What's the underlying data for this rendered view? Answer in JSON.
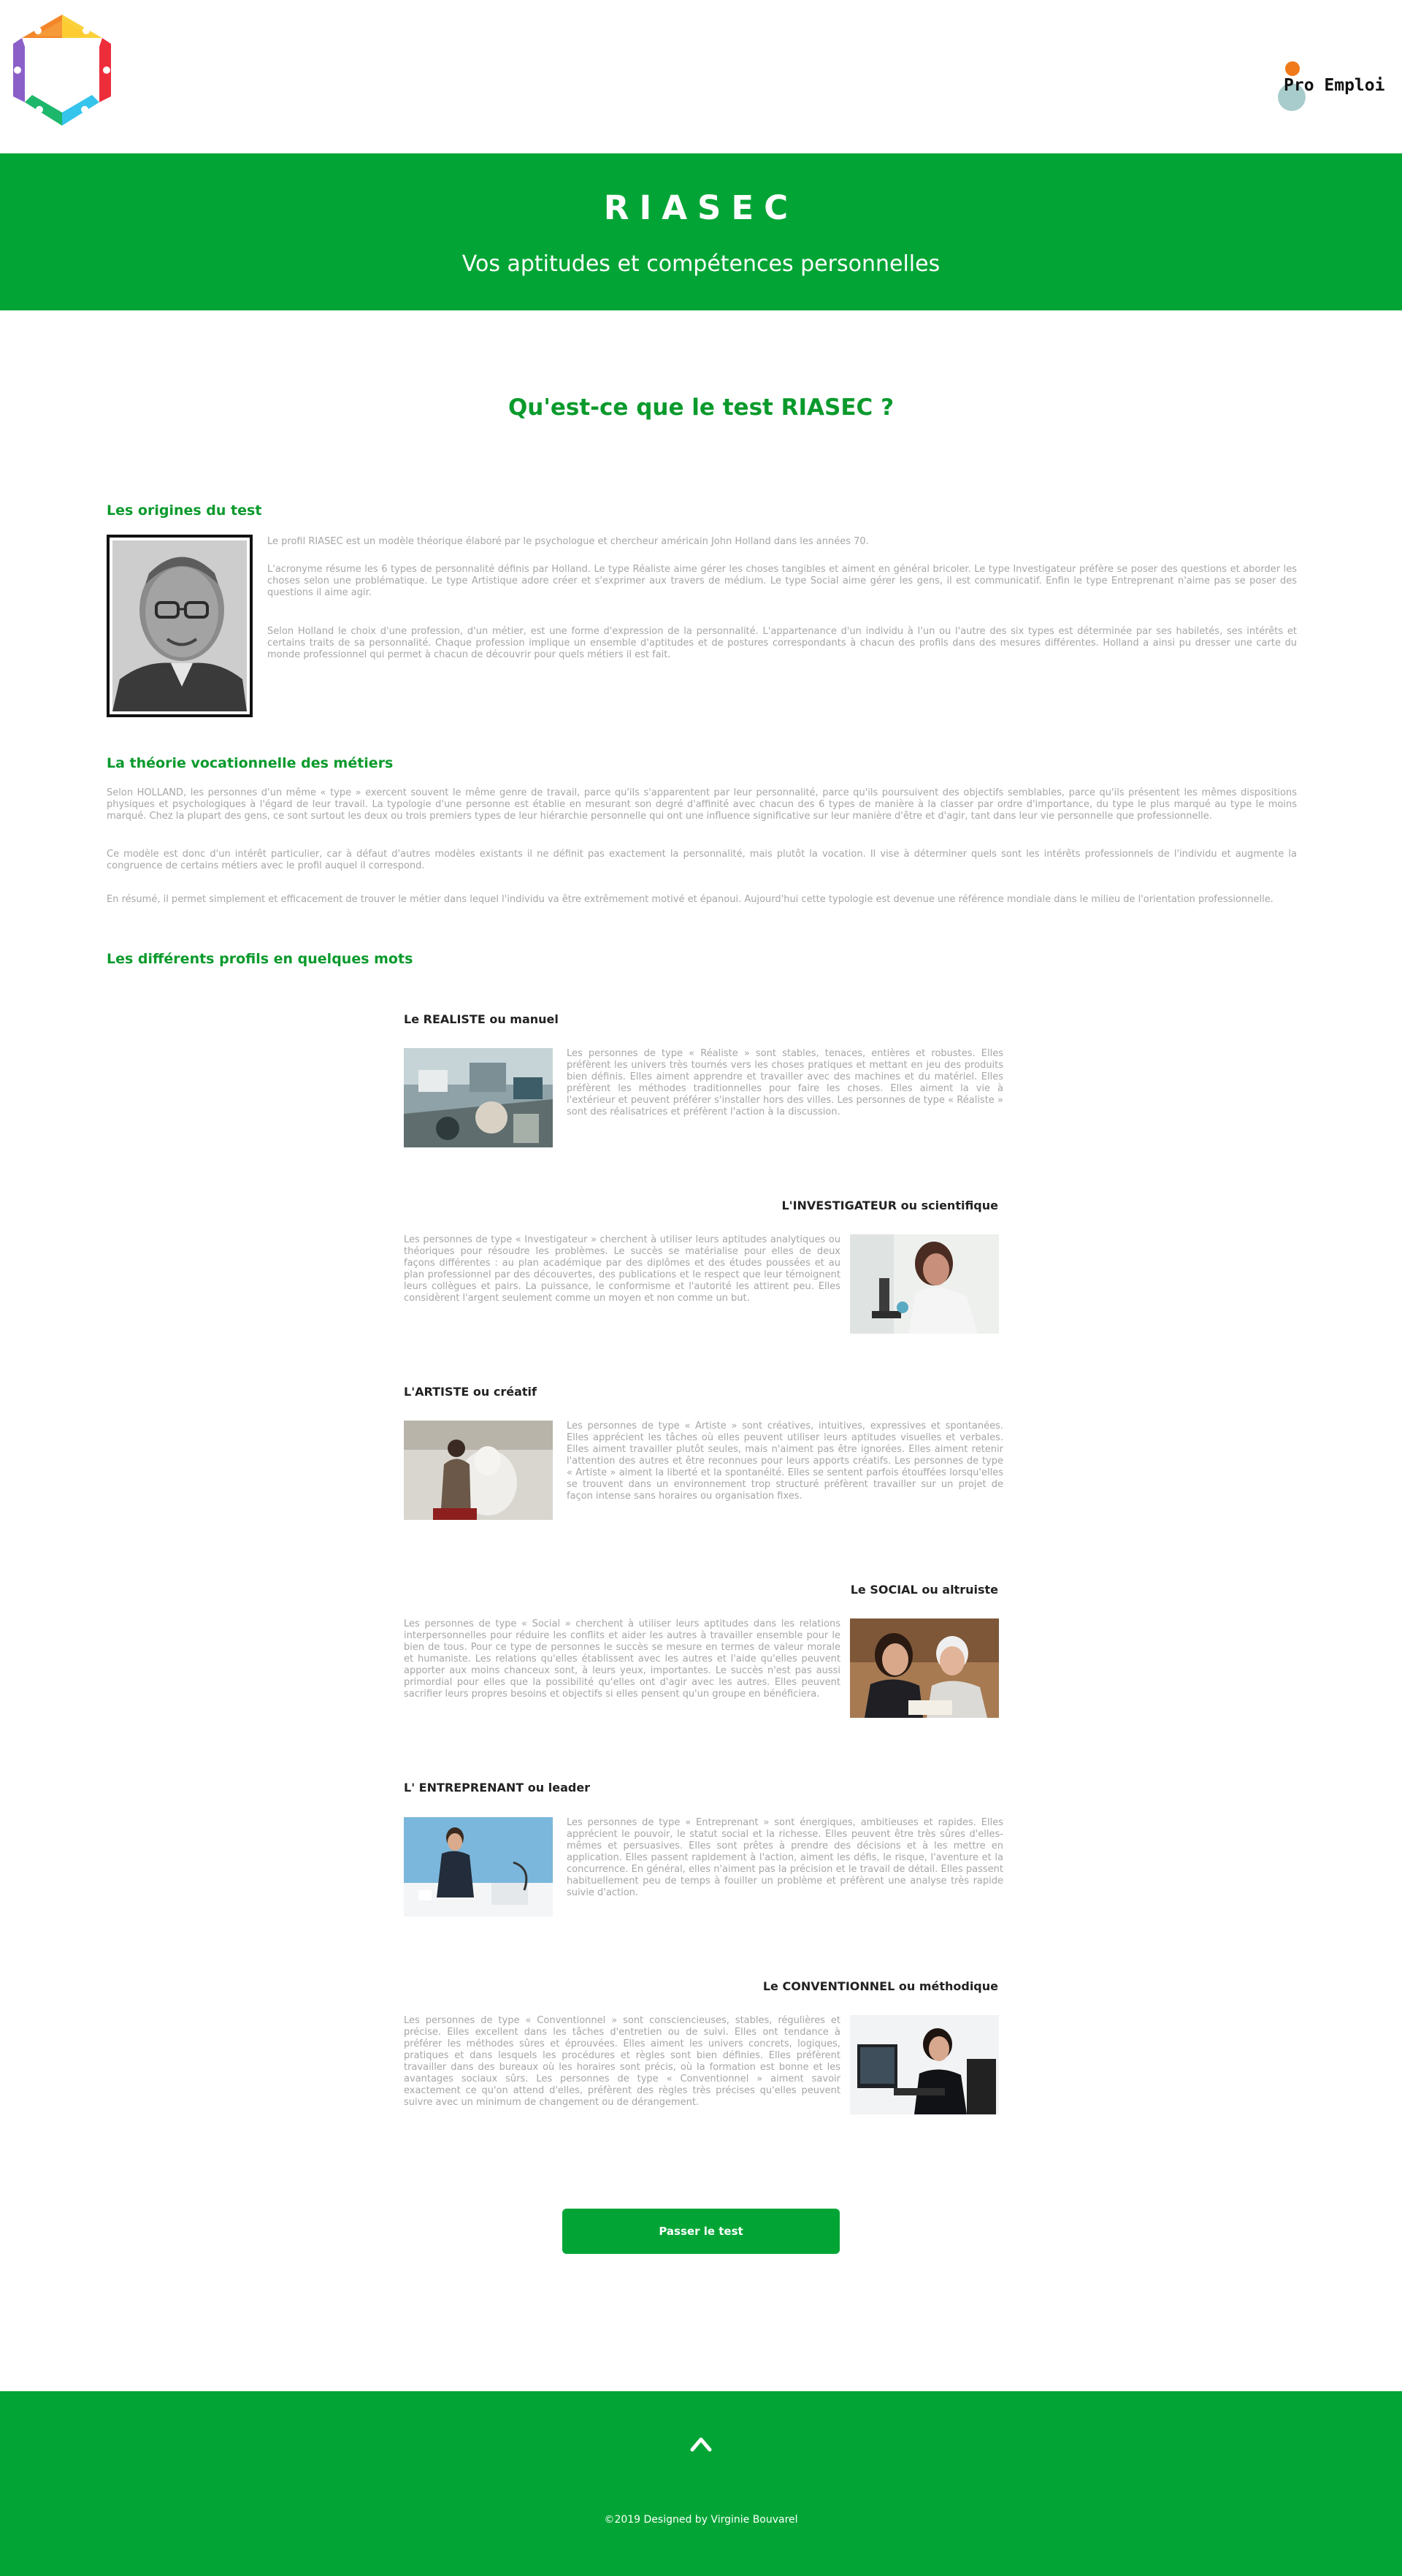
{
  "header": {
    "brand_name": "Pro Emploi",
    "logo_icon": "riasec-hexagon-logo-icon"
  },
  "hero": {
    "title": "RIASEC",
    "subtitle": "Vos aptitudes et compétences personnelles"
  },
  "main": {
    "title": "Qu'est-ce que le test RIASEC ?"
  },
  "origins": {
    "title": "Les origines du test",
    "paragraphs": [
      "Le profil RIASEC est un modèle théorique élaboré par le psychologue et chercheur américain John Holland dans les années 70.",
      "L'acronyme résume les 6 types de personnalité définis par Holland. Le type Réaliste aime gérer les choses tangibles et aiment en général bricoler. Le type Investigateur préfère se poser des questions et aborder les choses selon une problématique. Le type Artistique adore créer et s'exprimer aux travers de médium. Le type Social aime gérer les gens, il est communicatif. Enfin le type Entreprenant n'aime pas se poser des questions il aime agir.",
      "Selon Holland le choix d'une profession, d'un métier, est une forme d'expression de la personnalité. L'appartenance d'un individu à l'un ou l'autre des six types est déterminée par ses habiletés, ses intérêts et certains traits de sa personnalité. Chaque profession implique un ensemble d'aptitudes et de postures correspondants à chacun des profils dans des mesures différentes. Holland a ainsi pu dresser une carte du monde professionnel qui permet à chacun de découvrir pour quels métiers il est fait."
    ]
  },
  "theory": {
    "title": "La théorie vocationnelle des métiers",
    "paragraphs": [
      "Selon HOLLAND, les personnes d'un même « type » exercent souvent le même genre de travail, parce qu'ils s'apparentent par leur personnalité, parce qu'ils poursuivent des objectifs semblables, parce qu'ils présentent les mêmes dispositions physiques et psychologiques à l'égard de leur travail. La typologie d'une personne est établie en mesurant son degré d'affinité avec chacun des 6 types de manière à la classer par ordre d'importance, du type le plus marqué au type le moins marqué. Chez la plupart des gens, ce sont surtout les deux ou trois premiers types de leur hiérarchie personnelle qui ont une influence significative sur leur manière d'être et d'agir, tant dans leur vie personnelle que professionnelle.",
      "Ce modèle est donc d'un intérêt particulier, car à défaut d'autres modèles existants il ne définit pas exactement la personnalité, mais plutôt la vocation. Il vise à déterminer quels sont les intérêts professionnels de l'individu et augmente la congruence de certains métiers avec le profil auquel il correspond.",
      "En résumé, il permet simplement et efficacement de trouver le métier dans lequel l'individu va être extrêmement motivé et épanoui. Aujourd'hui cette typologie est devenue une référence mondiale dans le milieu de l'orientation professionnelle."
    ]
  },
  "profiles": {
    "title": "Les différents profils en quelques mots",
    "items": [
      {
        "title": "Le REALISTE ou manuel",
        "text": "Les personnes de type « Réaliste » sont stables, tenaces, entières et robustes. Elles préfèrent les univers très tournés vers les choses pratiques et mettant en jeu des produits bien définis. Elles aiment apprendre et travailler avec des machines et du matériel. Elles préfèrent les méthodes traditionnelles pour faire les choses. Elles aiment la vie à l'extérieur et peuvent préférer s'installer hors des villes. Les personnes de type « Réaliste » sont des réalisatrices et préfèrent l'action à la discussion."
      },
      {
        "title": "L'INVESTIGATEUR ou scientifique",
        "text": "Les personnes de type « Investigateur » cherchent à utiliser leurs aptitudes analytiques ou théoriques pour résoudre les problèmes. Le succès se matérialise pour elles de deux façons différentes : au plan académique par des diplômes et des études poussées et au plan professionnel par des découvertes, des publications et le respect que leur témoignent leurs collègues et pairs. La puissance, le conformisme et l'autorité les attirent peu. Elles considèrent l'argent seulement comme un moyen et non comme un but."
      },
      {
        "title": "L'ARTISTE ou créatif",
        "text": "Les personnes de type « Artiste » sont créatives, intuitives, expressives et spontanées. Elles apprécient les tâches où elles peuvent utiliser leurs aptitudes visuelles et verbales. Elles aiment travailler plutôt seules, mais n'aiment pas être ignorées. Elles aiment retenir l'attention des autres et être reconnues pour leurs apports créatifs. Les personnes de type « Artiste » aiment la liberté et la spontanéité. Elles se sentent parfois étouffées lorsqu'elles se trouvent dans un environnement trop structuré préfèrent travailler sur un projet de façon intense sans horaires ou organisation fixes."
      },
      {
        "title": "Le SOCIAL ou altruiste",
        "text": "Les personnes de type « Social » cherchent à utiliser leurs aptitudes dans les relations interpersonnelles pour réduire les conflits et aider les autres à travailler ensemble pour le bien de tous. Pour ce type de personnes le succès se mesure en termes de valeur morale et humaniste. Les relations qu'elles établissent avec les autres et l'aide qu'elles peuvent apporter aux moins chanceux sont, à leurs yeux, importantes. Le succès n'est pas aussi primordial pour elles que la possibilité qu'elles ont d'agir avec les autres. Elles peuvent sacrifier leurs propres besoins et objectifs si elles pensent qu'un groupe en bénéficiera."
      },
      {
        "title": "L' ENTREPRENANT ou leader",
        "text": "Les personnes de type « Entreprenant » sont énergiques, ambitieuses et rapides. Elles apprécient le pouvoir, le statut social et la richesse. Elles peuvent être très sûres d'elles-mêmes et persuasives. Elles sont prêtes à prendre des décisions et à les mettre en application. Elles passent rapidement à l'action, aiment les défis, le risque, l'aventure et la concurrence. En général, elles n'aiment pas la précision et le travail de détail. Elles passent habituellement peu de temps à fouiller un problème et préfèrent une analyse très rapide suivie d'action."
      },
      {
        "title": "Le CONVENTIONNEL ou méthodique",
        "text": "Les personnes de type « Conventionnel » sont consciencieuses, stables, régulières et précise. Elles excellent dans les tâches d'entretien ou de suivi. Elles ont tendance à préférer les méthodes sûres et éprouvées. Elles aiment les univers concrets, logiques, pratiques et dans lesquels les procédures et règles sont bien définies. Elles préfèrent travailler dans des bureaux où les horaires sont précis, où la formation est bonne et les avantages sociaux sûrs. Les personnes de type « Conventionnel » aiment savoir exactement ce qu'on attend d'elles, préfèrent des règles très précises qu'elles peuvent suivre avec un minimum de changement ou de dérangement."
      }
    ]
  },
  "cta": {
    "label": "Passer le test"
  },
  "footer": {
    "up_icon": "chevron-up-icon",
    "copyright": "©2019 Designed by Virginie Bouvarel"
  },
  "colors": {
    "brand_green": "#02a535",
    "title_green": "#0a9a2c",
    "accent_orange": "#f07a1a"
  }
}
